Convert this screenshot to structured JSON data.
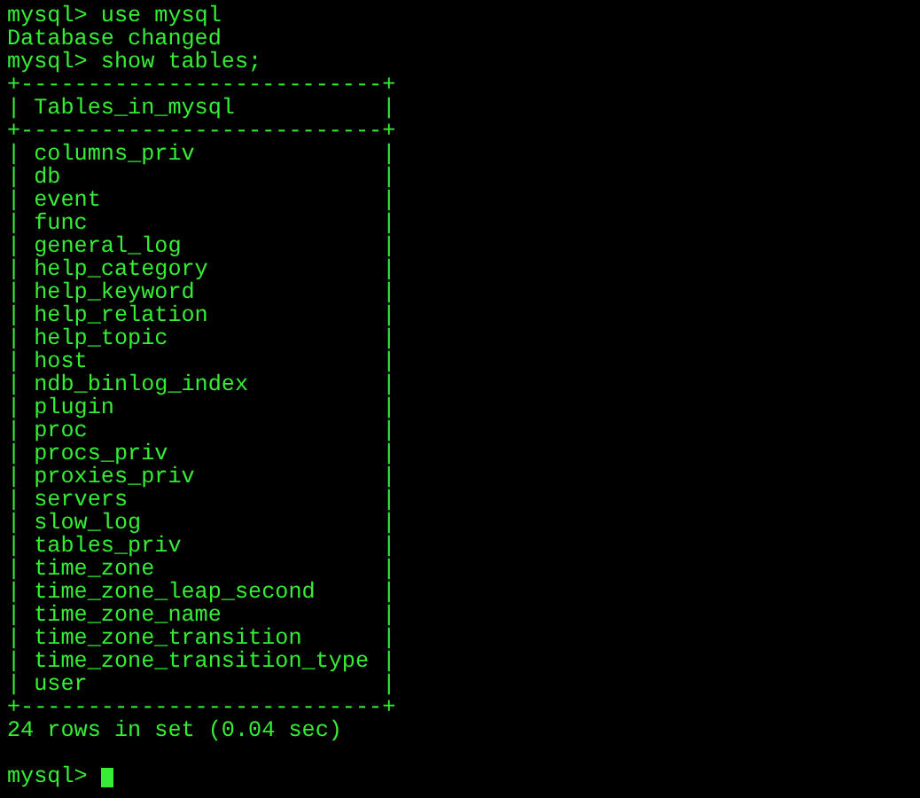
{
  "terminal": {
    "lines": [
      {
        "kind": "command",
        "text": "mysql> use mysql"
      },
      {
        "kind": "output",
        "text": "Database changed"
      },
      {
        "kind": "command",
        "text": "mysql> show tables;"
      },
      {
        "kind": "border",
        "text": "+---------------------------+"
      },
      {
        "kind": "header",
        "text": "| Tables_in_mysql           |"
      },
      {
        "kind": "border",
        "text": "+---------------------------+"
      },
      {
        "kind": "row",
        "text": "| columns_priv              |"
      },
      {
        "kind": "row",
        "text": "| db                        |"
      },
      {
        "kind": "row",
        "text": "| event                     |"
      },
      {
        "kind": "row",
        "text": "| func                      |"
      },
      {
        "kind": "row",
        "text": "| general_log               |"
      },
      {
        "kind": "row",
        "text": "| help_category             |"
      },
      {
        "kind": "row",
        "text": "| help_keyword              |"
      },
      {
        "kind": "row",
        "text": "| help_relation             |"
      },
      {
        "kind": "row",
        "text": "| help_topic                |"
      },
      {
        "kind": "row",
        "text": "| host                      |"
      },
      {
        "kind": "row",
        "text": "| ndb_binlog_index          |"
      },
      {
        "kind": "row",
        "text": "| plugin                    |"
      },
      {
        "kind": "row",
        "text": "| proc                      |"
      },
      {
        "kind": "row",
        "text": "| procs_priv                |"
      },
      {
        "kind": "row",
        "text": "| proxies_priv              |"
      },
      {
        "kind": "row",
        "text": "| servers                   |"
      },
      {
        "kind": "row",
        "text": "| slow_log                  |"
      },
      {
        "kind": "row",
        "text": "| tables_priv               |"
      },
      {
        "kind": "row",
        "text": "| time_zone                 |"
      },
      {
        "kind": "row",
        "text": "| time_zone_leap_second     |"
      },
      {
        "kind": "row",
        "text": "| time_zone_name            |"
      },
      {
        "kind": "row",
        "text": "| time_zone_transition      |"
      },
      {
        "kind": "row",
        "text": "| time_zone_transition_type |"
      },
      {
        "kind": "row",
        "text": "| user                      |"
      },
      {
        "kind": "border",
        "text": "+---------------------------+"
      },
      {
        "kind": "output",
        "text": "24 rows in set (0.04 sec)"
      },
      {
        "kind": "blank"
      },
      {
        "kind": "prompt",
        "text": "mysql>"
      }
    ]
  }
}
